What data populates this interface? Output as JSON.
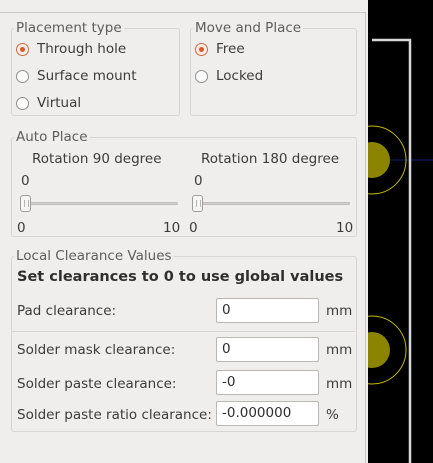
{
  "placement_type": {
    "title": "Placement type",
    "options": [
      {
        "label": "Through hole",
        "checked": true
      },
      {
        "label": "Surface mount",
        "checked": false
      },
      {
        "label": "Virtual",
        "checked": false
      }
    ]
  },
  "move_and_place": {
    "title": "Move and Place",
    "options": [
      {
        "label": "Free",
        "checked": true
      },
      {
        "label": "Locked",
        "checked": false
      }
    ]
  },
  "auto_place": {
    "title": "Auto Place",
    "rot90": {
      "label": "Rotation 90 degree",
      "value": "0",
      "min": "0",
      "max": "10",
      "level": 0
    },
    "rot180": {
      "label": "Rotation 180 degree",
      "value": "0",
      "min": "0",
      "max": "10",
      "level": 0
    }
  },
  "clearance": {
    "title": "Local Clearance Values",
    "heading": "Set clearances to 0 to use global values",
    "pad": {
      "label": "Pad clearance:",
      "value": "0",
      "unit": "mm"
    },
    "mask": {
      "label": "Solder mask clearance:",
      "value": "0",
      "unit": "mm"
    },
    "paste": {
      "label": "Solder paste clearance:",
      "value": "-0",
      "unit": "mm"
    },
    "ratio": {
      "label": "Solder paste ratio clearance:",
      "value": "-0.000000",
      "unit": "%"
    }
  },
  "colors": {
    "accent": "#df5628",
    "pad": "#8a8400",
    "outline": "#d8d8d8",
    "background": "#efeeec"
  }
}
